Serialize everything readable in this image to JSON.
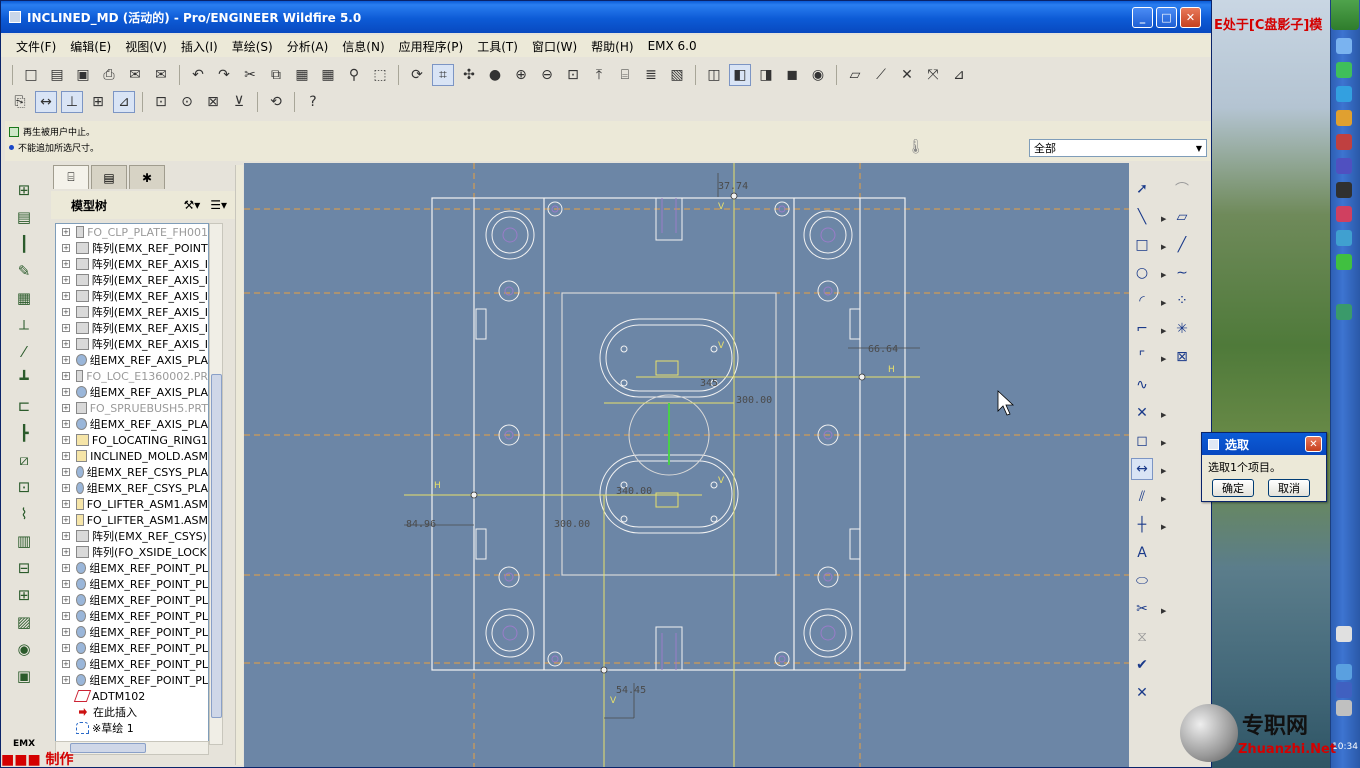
{
  "window": {
    "title": "INCLINED_MD (活动的) - Pro/ENGINEER Wildfire 5.0",
    "minimize": "_",
    "maximize": "□",
    "close": "✕"
  },
  "desktop": {
    "overlay_text": "E处于[C盘影子]模",
    "clock": "10:34"
  },
  "menu": [
    "文件(F)",
    "编辑(E)",
    "视图(V)",
    "插入(I)",
    "草绘(S)",
    "分析(A)",
    "信息(N)",
    "应用程序(P)",
    "工具(T)",
    "窗口(W)",
    "帮助(H)",
    "EMX 6.0"
  ],
  "messages": {
    "line1": "再生被用户中止。",
    "line2": "不能追加所选尺寸。"
  },
  "filter": {
    "value": "全部"
  },
  "model_tree": {
    "title": "模型树",
    "items": [
      {
        "label": "FO_CLP_PLATE_FH001",
        "kind": "pat",
        "dim": true
      },
      {
        "label": "阵列(EMX_REF_POINT",
        "kind": "pat",
        "dim": false
      },
      {
        "label": "阵列(EMX_REF_AXIS_I",
        "kind": "pat",
        "dim": false
      },
      {
        "label": "阵列(EMX_REF_AXIS_I",
        "kind": "pat",
        "dim": false
      },
      {
        "label": "阵列(EMX_REF_AXIS_I",
        "kind": "pat",
        "dim": false
      },
      {
        "label": "阵列(EMX_REF_AXIS_I",
        "kind": "pat",
        "dim": false
      },
      {
        "label": "阵列(EMX_REF_AXIS_I",
        "kind": "pat",
        "dim": false
      },
      {
        "label": "阵列(EMX_REF_AXIS_I",
        "kind": "pat",
        "dim": false
      },
      {
        "label": "组EMX_REF_AXIS_PLA",
        "kind": "grp",
        "dim": false
      },
      {
        "label": "FO_LOC_E1360002.PR",
        "kind": "pat",
        "dim": true
      },
      {
        "label": "组EMX_REF_AXIS_PLA",
        "kind": "grp",
        "dim": false
      },
      {
        "label": "FO_SPRUEBUSH5.PRT",
        "kind": "pat",
        "dim": true
      },
      {
        "label": "组EMX_REF_AXIS_PLA",
        "kind": "grp",
        "dim": false
      },
      {
        "label": "FO_LOCATING_RING1",
        "kind": "asm",
        "dim": false
      },
      {
        "label": "INCLINED_MOLD.ASM",
        "kind": "asm",
        "dim": false
      },
      {
        "label": "组EMX_REF_CSYS_PLA",
        "kind": "grp",
        "dim": false
      },
      {
        "label": "组EMX_REF_CSYS_PLA",
        "kind": "grp",
        "dim": false
      },
      {
        "label": "FO_LIFTER_ASM1.ASM",
        "kind": "asm",
        "dim": false
      },
      {
        "label": "FO_LIFTER_ASM1.ASM",
        "kind": "asm",
        "dim": false
      },
      {
        "label": "阵列(EMX_REF_CSYS)",
        "kind": "pat",
        "dim": false
      },
      {
        "label": "阵列(FO_XSIDE_LOCK",
        "kind": "pat",
        "dim": false
      },
      {
        "label": "组EMX_REF_POINT_PL",
        "kind": "grp",
        "dim": false
      },
      {
        "label": "组EMX_REF_POINT_PL",
        "kind": "grp",
        "dim": false
      },
      {
        "label": "组EMX_REF_POINT_PL",
        "kind": "grp",
        "dim": false
      },
      {
        "label": "组EMX_REF_POINT_PL",
        "kind": "grp",
        "dim": false
      },
      {
        "label": "组EMX_REF_POINT_PL",
        "kind": "grp",
        "dim": false
      },
      {
        "label": "组EMX_REF_POINT_PL",
        "kind": "grp",
        "dim": false
      },
      {
        "label": "组EMX_REF_POINT_PL",
        "kind": "grp",
        "dim": false
      },
      {
        "label": "组EMX_REF_POINT_PL",
        "kind": "grp",
        "dim": false
      },
      {
        "label": "ADTM102",
        "kind": "dtm",
        "dim": false
      },
      {
        "label": "在此插入",
        "kind": "ins",
        "dim": false
      },
      {
        "label": "※草绘 1",
        "kind": "skt",
        "dim": false
      }
    ]
  },
  "left_toolbar_label": "EMX",
  "footer_mark": "■■■ 制作",
  "drawing": {
    "dims": {
      "top": "37.74",
      "right": "66.64",
      "center_h": "300.00",
      "center_v": "345",
      "inner_h": "340.00",
      "lower_h": "300.00",
      "left": "84.96",
      "bottom": "54.45"
    },
    "labels": {
      "h1": "H",
      "h2": "H",
      "v1": "V",
      "v2": "V",
      "v3": "V",
      "v4": "V"
    }
  },
  "select_dialog": {
    "title": "选取",
    "body": "选取1个项目。",
    "ok": "确定",
    "cancel": "取消"
  },
  "watermark": {
    "name": "专职网",
    "url": "Zhuanzhi.Net"
  },
  "colors": {
    "graphics_bg": "#6c86a6",
    "outline": "#f2f2f2",
    "sketch": "#e8e06a",
    "centerline": "#e8a040",
    "dim": "#5a5a5a"
  }
}
